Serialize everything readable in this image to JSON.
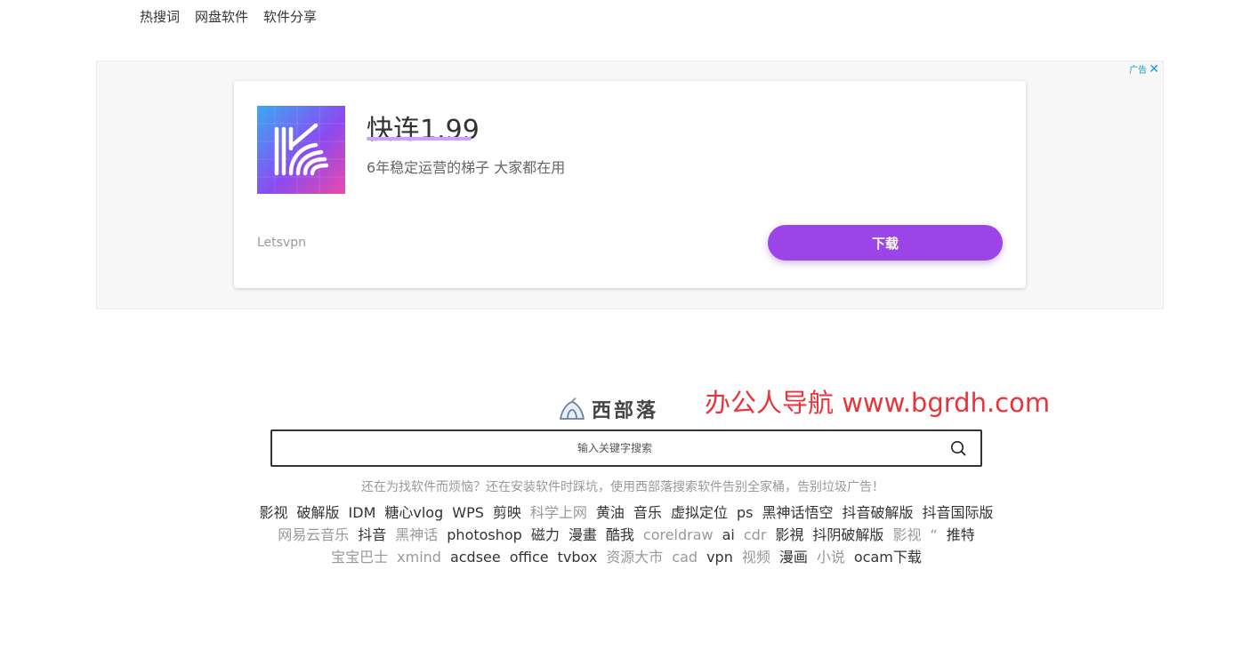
{
  "topnav": {
    "items": [
      "热搜词",
      "网盘软件",
      "软件分享"
    ]
  },
  "ad": {
    "badge": "广告",
    "title": "快连1.99",
    "subtitle": "6年稳定运营的梯子 大家都在用",
    "brand": "Letsvpn",
    "button": "下载",
    "colors": {
      "button": "#9b45e8",
      "underline": "#c9a3ff"
    }
  },
  "site": {
    "logo_text": "西部落",
    "watermark": "办公人导航 www.bgrdh.com"
  },
  "search": {
    "placeholder": "输入关键字搜索",
    "icon": "search-icon"
  },
  "tagline": "还在为找软件而烦恼？还在安装软件时踩坑，使用西部落搜索软件告别全家桶，告别垃圾广告！",
  "hot_tags": {
    "row1": [
      {
        "text": "影视",
        "style": "dark"
      },
      {
        "text": "破解版",
        "style": "dark"
      },
      {
        "text": "IDM",
        "style": "dark"
      },
      {
        "text": "糖心vlog",
        "style": "dark"
      },
      {
        "text": "WPS",
        "style": "dark"
      },
      {
        "text": "剪映",
        "style": "dark"
      },
      {
        "text": "科学上网",
        "style": "light"
      },
      {
        "text": "黄油",
        "style": "dark"
      },
      {
        "text": "音乐",
        "style": "dark"
      },
      {
        "text": "虚拟定位",
        "style": "dark"
      },
      {
        "text": "ps",
        "style": "dark"
      },
      {
        "text": "黑神话悟空",
        "style": "dark"
      },
      {
        "text": "抖音破解版",
        "style": "dark"
      },
      {
        "text": "抖音国际版",
        "style": "dark"
      }
    ],
    "row2": [
      {
        "text": "网易云音乐",
        "style": "light"
      },
      {
        "text": "抖音",
        "style": "dark"
      },
      {
        "text": "黑神话",
        "style": "light"
      },
      {
        "text": "photoshop",
        "style": "dark"
      },
      {
        "text": "磁力",
        "style": "dark"
      },
      {
        "text": "漫畫",
        "style": "dark"
      },
      {
        "text": "酷我",
        "style": "dark"
      },
      {
        "text": "coreldraw",
        "style": "light"
      },
      {
        "text": "ai",
        "style": "dark"
      },
      {
        "text": "cdr",
        "style": "light"
      },
      {
        "text": "影視",
        "style": "dark"
      },
      {
        "text": "抖阴破解版",
        "style": "dark"
      },
      {
        "text": "影视",
        "style": "light"
      },
      {
        "text": "“",
        "style": "light"
      },
      {
        "text": "推特",
        "style": "dark"
      }
    ],
    "row3": [
      {
        "text": "宝宝巴士",
        "style": "light"
      },
      {
        "text": "xmind",
        "style": "light"
      },
      {
        "text": "acdsee",
        "style": "dark"
      },
      {
        "text": "office",
        "style": "dark"
      },
      {
        "text": "tvbox",
        "style": "dark"
      },
      {
        "text": "资源大市",
        "style": "light"
      },
      {
        "text": "cad",
        "style": "light"
      },
      {
        "text": "vpn",
        "style": "dark"
      },
      {
        "text": "视频",
        "style": "light"
      },
      {
        "text": "漫画",
        "style": "dark"
      },
      {
        "text": "小说",
        "style": "light"
      },
      {
        "text": "ocam下载",
        "style": "dark"
      }
    ]
  }
}
